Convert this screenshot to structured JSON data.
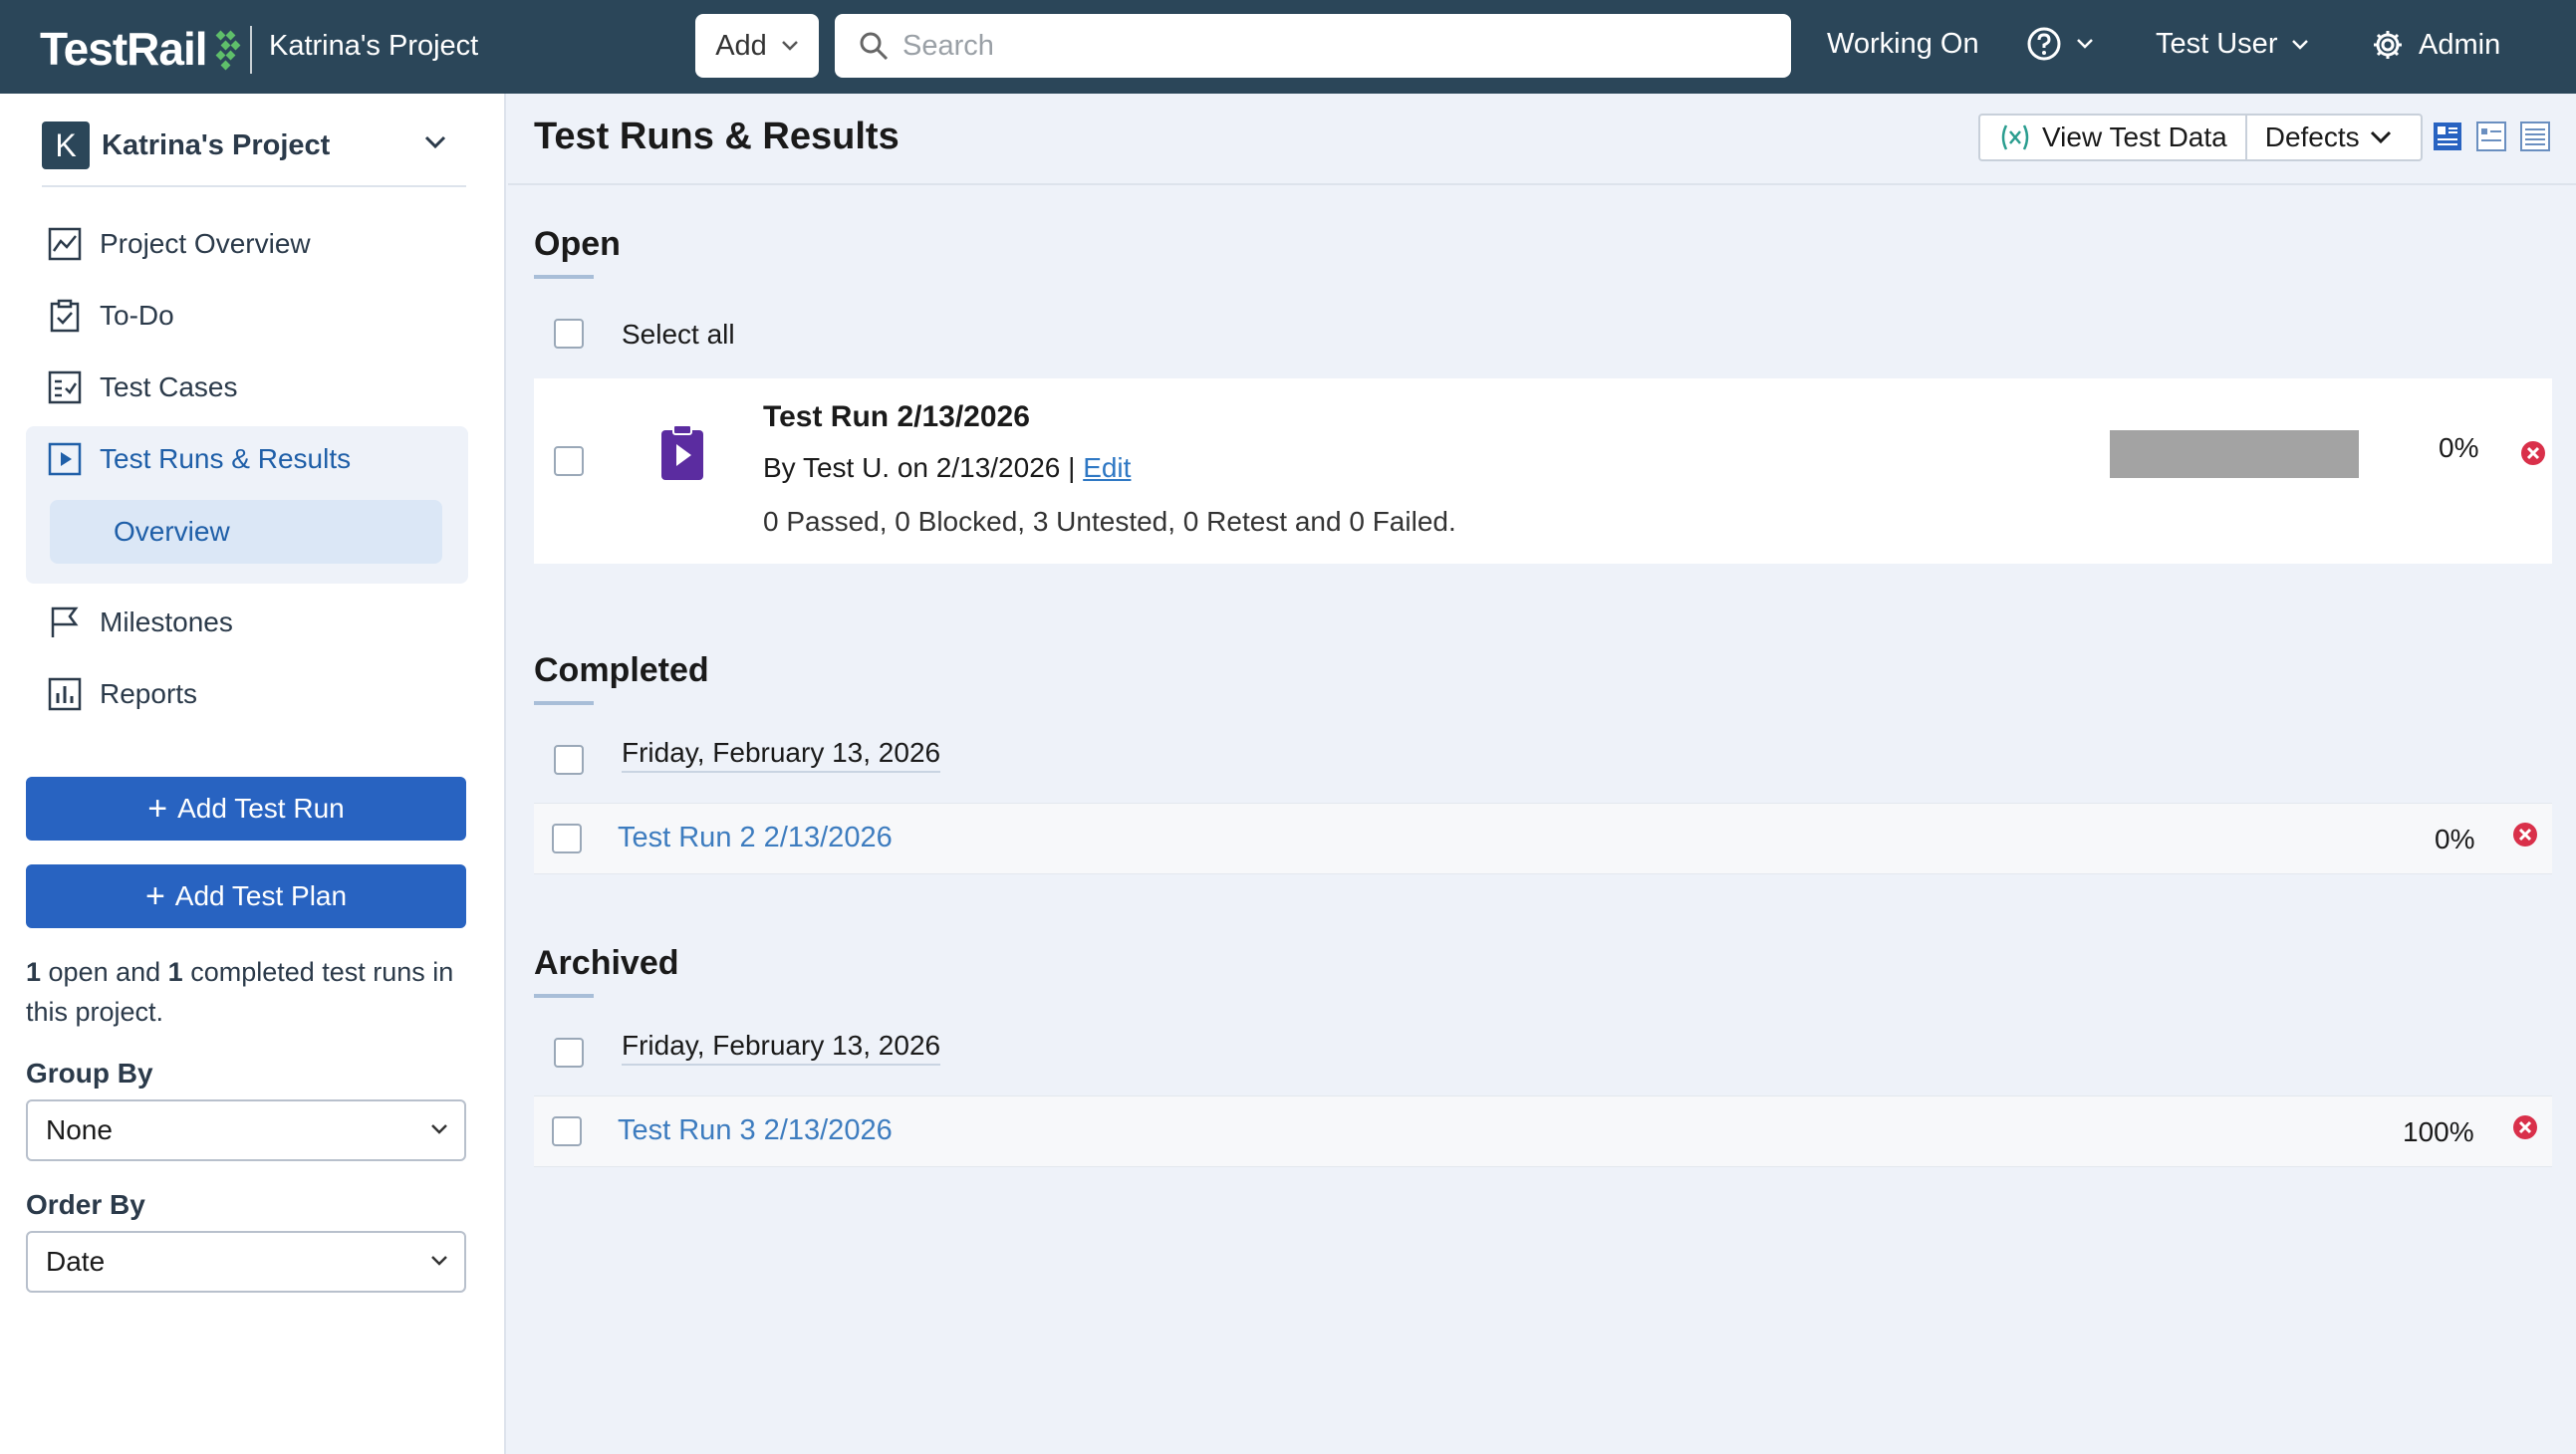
{
  "header": {
    "logo_text": "TestRail",
    "project_name": "Katrina's Project",
    "add_label": "Add",
    "search_placeholder": "Search",
    "working_on": "Working On",
    "user": "Test User",
    "admin": "Admin"
  },
  "sidebar": {
    "project_initial": "K",
    "project_name": "Katrina's Project",
    "nav": [
      {
        "label": "Project Overview",
        "icon": "chart-icon"
      },
      {
        "label": "To-Do",
        "icon": "clipboard-check-icon"
      },
      {
        "label": "Test Cases",
        "icon": "checklist-icon"
      },
      {
        "label": "Test Runs & Results",
        "icon": "play-square-icon"
      },
      {
        "label": "Milestones",
        "icon": "flag-icon"
      },
      {
        "label": "Reports",
        "icon": "bar-chart-icon"
      }
    ],
    "sub_nav": "Overview",
    "add_test_run": "Add Test Run",
    "add_test_plan": "Add Test Plan",
    "summary": {
      "open_count": "1",
      "open_text": " open and ",
      "completed_count": "1",
      "completed_text": " completed test runs in this project."
    },
    "group_by_label": "Group By",
    "group_by_value": "None",
    "order_by_label": "Order By",
    "order_by_value": "Date"
  },
  "main": {
    "title": "Test Runs & Results",
    "view_test_data": "View Test Data",
    "defects": "Defects",
    "open": {
      "title": "Open",
      "select_all": "Select all",
      "run": {
        "title": "Test Run 2/13/2026",
        "by": "By Test U. on 2/13/2026 | ",
        "edit": "Edit",
        "stats": "0 Passed, 0 Blocked, 3 Untested, 0 Retest and 0 Failed.",
        "percent": "0%"
      }
    },
    "completed": {
      "title": "Completed",
      "date": "Friday, February 13, 2026",
      "run": {
        "title": "Test Run 2 2/13/2026",
        "percent": "0%"
      }
    },
    "archived": {
      "title": "Archived",
      "date": "Friday, February 13, 2026",
      "run": {
        "title": "Test Run 3 2/13/2026",
        "percent": "100%"
      }
    }
  },
  "colors": {
    "topbar": "#2b4659",
    "primary": "#2863c1",
    "link": "#3d7cbf",
    "danger": "#d9304a",
    "run_icon": "#5b2ca0"
  }
}
